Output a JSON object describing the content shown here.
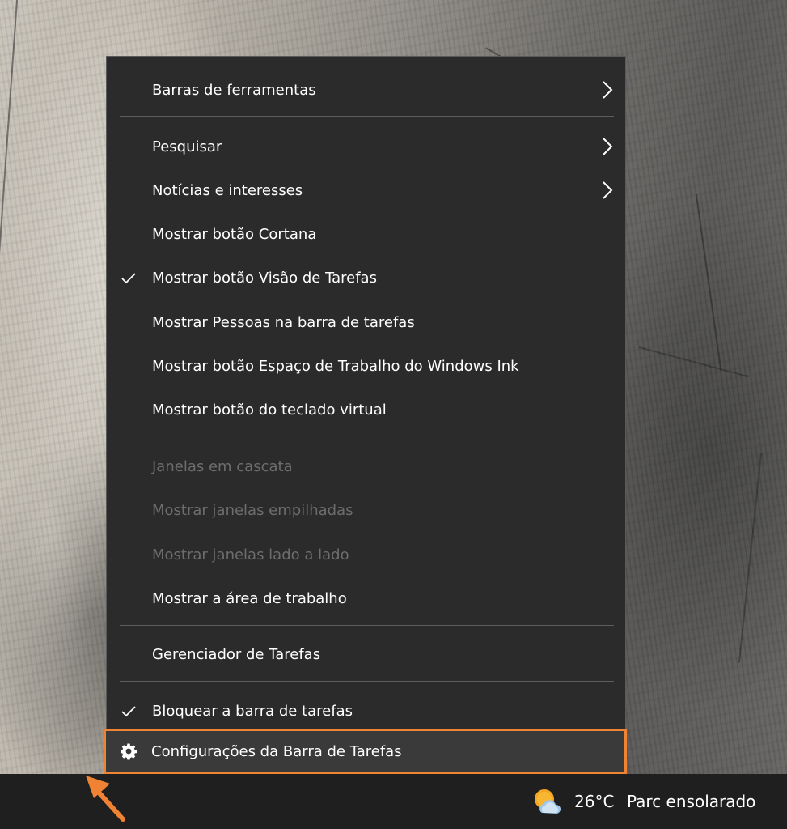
{
  "context_menu": {
    "items": [
      {
        "label": "Barras de ferramentas",
        "submenu": true
      },
      {
        "label": "Pesquisar",
        "submenu": true
      },
      {
        "label": "Notícias e interesses",
        "submenu": true
      },
      {
        "label": "Mostrar botão Cortana"
      },
      {
        "label": "Mostrar botão Visão de Tarefas",
        "checked": true
      },
      {
        "label": "Mostrar Pessoas na barra de tarefas"
      },
      {
        "label": "Mostrar botão Espaço de Trabalho do Windows Ink"
      },
      {
        "label": "Mostrar botão do teclado virtual"
      },
      {
        "label": "Janelas em cascata",
        "disabled": true
      },
      {
        "label": "Mostrar janelas empilhadas",
        "disabled": true
      },
      {
        "label": "Mostrar janelas lado a lado",
        "disabled": true
      },
      {
        "label": "Mostrar a área de trabalho"
      },
      {
        "label": "Gerenciador de Tarefas"
      },
      {
        "label": "Bloquear a barra de tarefas",
        "checked": true
      },
      {
        "label": "Configurações da Barra de Tarefas",
        "icon": "gear-icon",
        "highlighted": true
      }
    ]
  },
  "taskbar": {
    "weather": {
      "icon": "partly-sunny-icon",
      "temperature": "26°C",
      "condition": "Parc ensolarado"
    }
  },
  "colors": {
    "menu_background": "#2b2b2b",
    "highlight_border": "#f08233",
    "annotation_arrow": "#f08233",
    "disabled_text": "#6d6d6d"
  }
}
